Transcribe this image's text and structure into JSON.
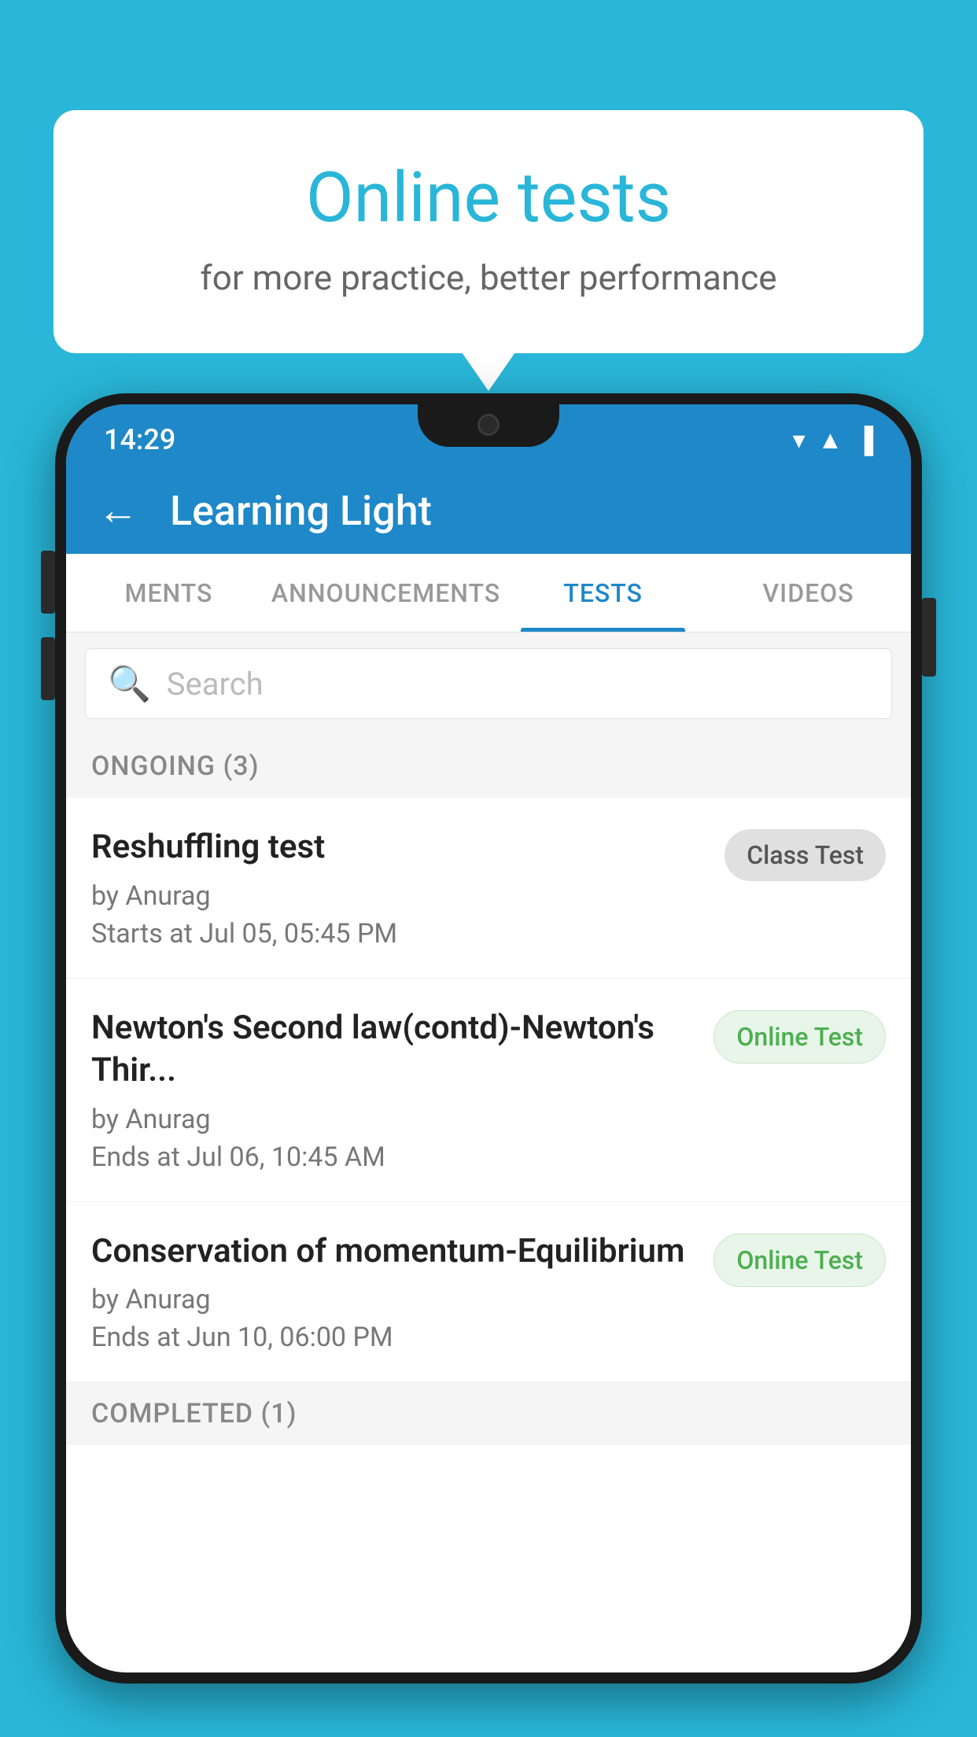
{
  "background": {
    "color": "#29b6d8"
  },
  "speech_bubble": {
    "title": "Online tests",
    "subtitle": "for more practice, better performance"
  },
  "phone": {
    "status_bar": {
      "time": "14:29",
      "icons": [
        "wifi",
        "signal",
        "battery"
      ]
    },
    "header": {
      "back_label": "←",
      "title": "Learning Light"
    },
    "tabs": [
      {
        "label": "MENTS",
        "active": false
      },
      {
        "label": "ANNOUNCEMENTS",
        "active": false
      },
      {
        "label": "TESTS",
        "active": true
      },
      {
        "label": "VIDEOS",
        "active": false
      }
    ],
    "search": {
      "placeholder": "Search"
    },
    "ongoing_section": {
      "label": "ONGOING (3)"
    },
    "tests": [
      {
        "name": "Reshuffling test",
        "by": "by Anurag",
        "time_label": "Starts at",
        "time": "Jul 05, 05:45 PM",
        "badge": "Class Test",
        "badge_type": "class"
      },
      {
        "name": "Newton's Second law(contd)-Newton's Thir...",
        "by": "by Anurag",
        "time_label": "Ends at",
        "time": "Jul 06, 10:45 AM",
        "badge": "Online Test",
        "badge_type": "online"
      },
      {
        "name": "Conservation of momentum-Equilibrium",
        "by": "by Anurag",
        "time_label": "Ends at",
        "time": "Jun 10, 06:00 PM",
        "badge": "Online Test",
        "badge_type": "online"
      }
    ],
    "completed_section": {
      "label": "COMPLETED (1)"
    }
  }
}
